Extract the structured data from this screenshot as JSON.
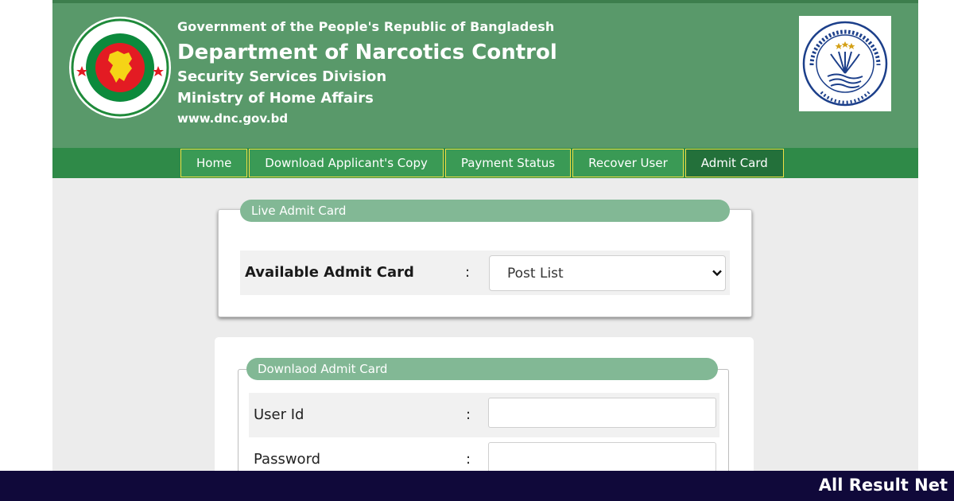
{
  "header": {
    "government": "Government of the People's Republic of Bangladesh",
    "department": "Department of Narcotics Control",
    "division": "Security Services Division",
    "ministry": "Ministry of Home Affairs",
    "website": "www.dnc.gov.bd",
    "seal_text": "গণপ্রজাতন্ত্রী বাংলাদেশ সরকার",
    "logo_text": "DEPARTMENT OF NARCOTICS CONTROL",
    "colors": {
      "header_bg": "#59996a",
      "nav_bg": "#2f8a48",
      "nav_border": "#f0e045"
    }
  },
  "nav": {
    "items": [
      {
        "label": "Home",
        "active": false
      },
      {
        "label": "Download Applicant's Copy",
        "active": false
      },
      {
        "label": "Payment Status",
        "active": false
      },
      {
        "label": "Recover User",
        "active": false
      },
      {
        "label": "Admit Card",
        "active": true
      }
    ]
  },
  "live_admit": {
    "legend": "Live Admit Card",
    "label": "Available Admit Card",
    "colon": ":",
    "select_value": "Post List"
  },
  "download_admit": {
    "legend": "Downlaod Admit Card",
    "fields": [
      {
        "label": "User Id",
        "colon": ":",
        "value": ""
      },
      {
        "label": "Password",
        "colon": ":",
        "value": ""
      }
    ]
  },
  "footer": {
    "brand": "All Result Net"
  }
}
